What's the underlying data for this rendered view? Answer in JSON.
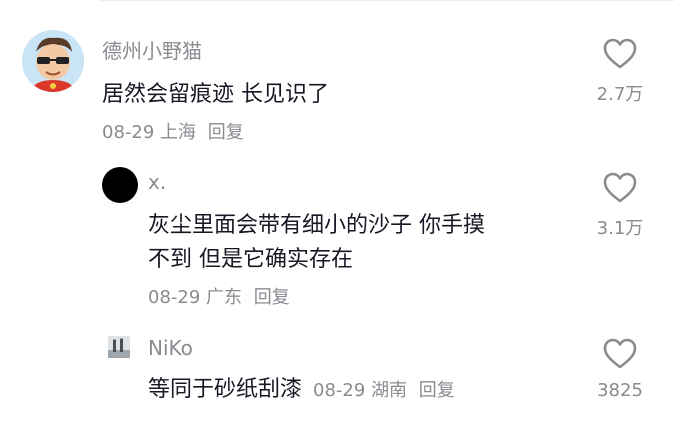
{
  "comments": [
    {
      "username": "德州小野猫",
      "text": "居然会留痕迹 长见识了",
      "date": "08-29",
      "location": "上海",
      "reply_label": "回复",
      "like_count": "2.7万",
      "avatar_icon": "cartoon-boy-sunglasses-avatar"
    },
    {
      "username": "x.",
      "text_lines": [
        "灰尘里面会带有细小的沙子 你手摸",
        "不到 但是它确实存在"
      ],
      "date": "08-29",
      "location": "广东",
      "reply_label": "回复",
      "like_count": "3.1万",
      "avatar_icon": "black-circle-avatar"
    },
    {
      "username": "NiKo",
      "text": "等同于砂纸刮漆",
      "date": "08-29",
      "location": "湖南",
      "reply_label": "回复",
      "like_count": "3825",
      "avatar_icon": "photo-thumbnail-avatar"
    }
  ],
  "colors": {
    "primary_text": "#161823",
    "secondary_text": "#8a8b91",
    "heart_outline": "#8a8b91"
  },
  "icons": {
    "like": "heart-outline-icon"
  }
}
